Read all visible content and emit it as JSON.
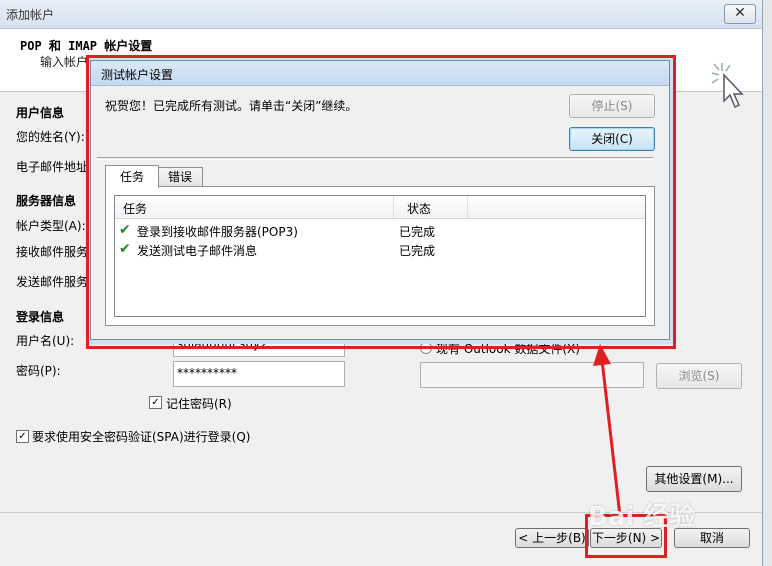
{
  "window": {
    "title": "添加帐户",
    "close_glyph": "✕"
  },
  "header": {
    "title": "POP 和 IMAP 帐户设置",
    "subtitle": "输入帐户的邮件服务器设置。"
  },
  "sections": {
    "user_info": "用户信息",
    "server_info": "服务器信息",
    "login_info": "登录信息"
  },
  "labels": {
    "name": "您的姓名(Y):",
    "email": "电子邮件地址",
    "account_type": "帐户类型(A):",
    "incoming": "接收邮件服务",
    "outgoing": "发送邮件服务",
    "username": "用户名(U):",
    "password": "密码(P):"
  },
  "fields": {
    "username_value": "shiauunui suy2",
    "password_value": "**********"
  },
  "checkboxes": {
    "remember_password": "记住密码(R)",
    "require_spa": "要求使用安全密码验证(SPA)进行登录(Q)"
  },
  "right": {
    "existing_data_file": "现有 Outlook 数据文件(X)",
    "browse": "浏览(S)",
    "more_settings": "其他设置(M)..."
  },
  "footer": {
    "back": "< 上一步(B)",
    "next": "下一步(N) >",
    "cancel": "取消"
  },
  "dialog": {
    "title": "测试帐户设置",
    "message": "祝贺您！已完成所有测试。请单击“关闭”继续。",
    "stop": "停止(S)",
    "close": "关闭(C)",
    "tabs": [
      "任务",
      "错误"
    ],
    "columns": [
      "任务",
      "状态"
    ],
    "rows": [
      {
        "task": "登录到接收邮件服务器(POP3)",
        "status": "已完成"
      },
      {
        "task": "发送测试电子邮件消息",
        "status": "已完成"
      }
    ]
  },
  "watermark": "Bai 经验",
  "colors": {
    "annotation_red": "#e02020",
    "check_green": "#1e8a1e"
  }
}
